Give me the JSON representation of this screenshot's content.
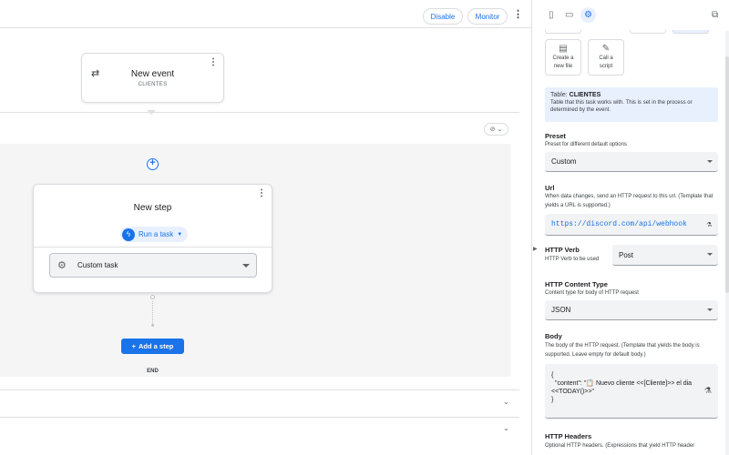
{
  "topbar": {
    "disable_label": "Disable",
    "monitor_label": "Monitor"
  },
  "event": {
    "title": "New event",
    "subtitle": "CLIENTES",
    "icon": "shuffle-icon"
  },
  "step": {
    "title": "New step",
    "run_task_label": "Run a task",
    "task_select_value": "Custom task",
    "add_step_label": "Add a step",
    "end_label": "END"
  },
  "panel": {
    "tiles": [
      {
        "label1": "Create a",
        "label2": "new file",
        "icon": "file-icon"
      },
      {
        "label1": "Call a",
        "label2": "script",
        "icon": "script-icon"
      }
    ],
    "table_info": {
      "prefix": "Table:",
      "name": "CLIENTES",
      "description": "Table that this task works with. This is set in the process or determined by the event."
    },
    "preset": {
      "title": "Preset",
      "desc": "Preset for different default options",
      "value": "Custom"
    },
    "url": {
      "title": "Url",
      "desc": "When data changes, send an HTTP request to this url. (Template that yields a URL is supported.)",
      "value": "https://discord.com/api/webhook"
    },
    "http_verb": {
      "title": "HTTP Verb",
      "desc": "HTTP Verb to be used",
      "value": "Post"
    },
    "content_type": {
      "title": "HTTP Content Type",
      "desc": "Content type for body of HTTP request",
      "value": "JSON"
    },
    "body": {
      "title": "Body",
      "desc": "The body of the HTTP request. (Template that yields the body is supported. Leave empty for default body.)",
      "line1": "{",
      "line2": "\"content\": \"📋 Nuevo cliente  <<[Cliente]>> el dia",
      "line3": "<<TODAY()>>\"",
      "line4": "}"
    },
    "headers": {
      "title": "HTTP Headers",
      "desc": "Optional HTTP headers. (Expressions that yield HTTP header"
    }
  },
  "colors": {
    "accent": "#1a73e8",
    "accent_light": "#e8f0fe",
    "canvas_gray": "#f5f5f6",
    "border": "#dadce0"
  }
}
